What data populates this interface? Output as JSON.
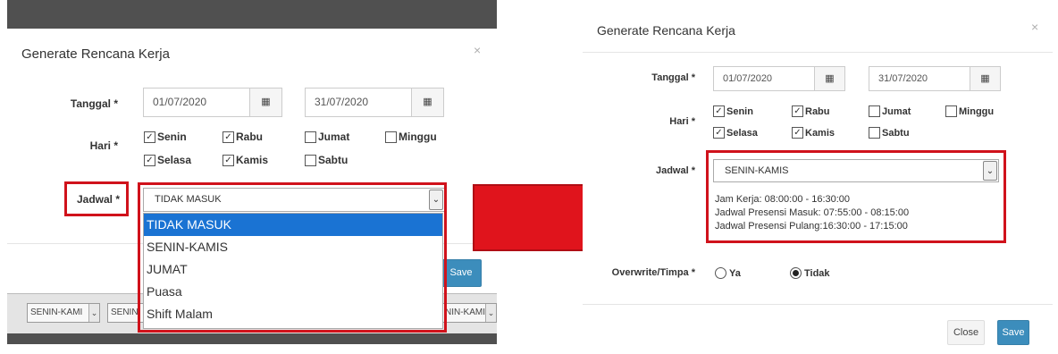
{
  "left": {
    "modal_title": "Generate Rencana Kerja",
    "close_icon": "×",
    "tanggal_label": "Tanggal *",
    "date_from": "01/07/2020",
    "date_to": "31/07/2020",
    "calendar_icon": "calendar-icon",
    "hari_label": "Hari *",
    "days": [
      {
        "label": "Senin",
        "checked": true
      },
      {
        "label": "Rabu",
        "checked": true
      },
      {
        "label": "Jumat",
        "checked": false
      },
      {
        "label": "Minggu",
        "checked": false
      },
      {
        "label": "Selasa",
        "checked": true
      },
      {
        "label": "Kamis",
        "checked": true
      },
      {
        "label": "Sabtu",
        "checked": false
      }
    ],
    "jadwal_label": "Jadwal *",
    "jadwal_value": "TIDAK MASUK",
    "dropdown_options": [
      "TIDAK MASUK",
      "SENIN-KAMIS",
      "JUMAT",
      "Puasa",
      "Shift Malam"
    ],
    "dropdown_selected": "TIDAK MASUK",
    "save_label": "Save",
    "background_selects": [
      "SENIN-KAMI",
      "SENIN",
      "NIN-KAMI"
    ]
  },
  "arrow_color": "#e0141c",
  "highlight_color": "#d0121b",
  "right": {
    "modal_title": "Generate Rencana Kerja",
    "close_icon": "×",
    "tanggal_label": "Tanggal *",
    "date_from": "01/07/2020",
    "date_to": "31/07/2020",
    "hari_label": "Hari *",
    "days": [
      {
        "label": "Senin",
        "checked": true
      },
      {
        "label": "Rabu",
        "checked": true
      },
      {
        "label": "Jumat",
        "checked": false
      },
      {
        "label": "Minggu",
        "checked": false
      },
      {
        "label": "Selasa",
        "checked": true
      },
      {
        "label": "Kamis",
        "checked": true
      },
      {
        "label": "Sabtu",
        "checked": false
      }
    ],
    "jadwal_label": "Jadwal *",
    "jadwal_value": "SENIN-KAMIS",
    "info_lines": [
      "Jam Kerja: 08:00:00 - 16:30:00",
      "Jadwal Presensi Masuk: 07:55:00 - 08:15:00",
      "Jadwal Presensi Pulang:16:30:00 - 17:15:00"
    ],
    "overwrite_label": "Overwrite/Timpa *",
    "radio_ya": "Ya",
    "radio_tidak": "Tidak",
    "radio_selected": "Tidak",
    "close_button": "Close",
    "save_button": "Save"
  }
}
